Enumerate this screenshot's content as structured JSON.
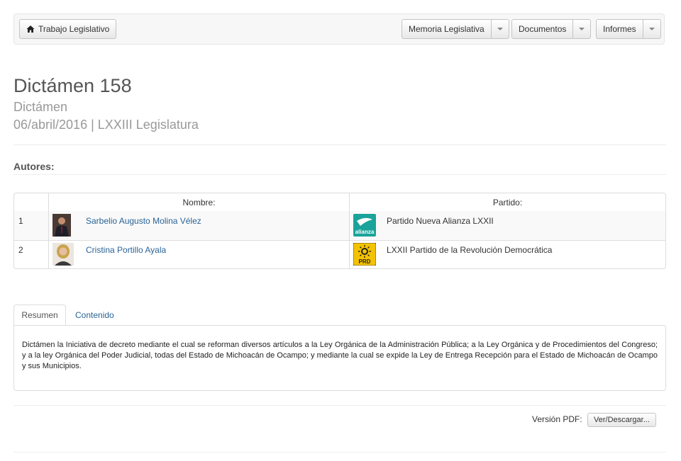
{
  "navbar": {
    "home_label": "Trabajo Legislativo",
    "menus": [
      {
        "label": "Memoria Legislativa"
      },
      {
        "label": "Documentos"
      },
      {
        "label": "Informes"
      }
    ]
  },
  "header": {
    "title": "Dictámen 158",
    "subtitle": "Dictámen",
    "date_line": "06/abril/2016 | LXXIII Legislatura"
  },
  "authors": {
    "section_label": "Autores:",
    "columns": [
      "Nombre:",
      "Partido:"
    ],
    "rows": [
      {
        "index": "1",
        "name": "Sarbelio Augusto Molina Vélez",
        "party": "Partido Nueva Alianza LXXII",
        "party_logo": "nueva-alianza-logo"
      },
      {
        "index": "2",
        "name": "Cristina Portillo Ayala",
        "party": "LXXII Partido de la Revolución Democrática",
        "party_logo": "prd-logo"
      }
    ]
  },
  "tabs": [
    {
      "label": "Resumen",
      "active": true
    },
    {
      "label": "Contenido",
      "active": false
    }
  ],
  "summary_text": "Dictámen la Iniciativa de decreto mediante el cual se reforman diversos artículos a la Ley Orgánica de la Administración Pública; a la Ley Orgánica y de Procedimientos del Congreso; y a la ley Orgánica del Poder Judicial, todas del Estado de Michoacán de Ocampo; y mediante la cual se expide la Ley de Entrega Recepción para el Estado de Michoacán de Ocampo y sus Municipios.",
  "pdf": {
    "label": "Versión PDF:",
    "button_label": "Ver/Descargar..."
  },
  "logo_text": {
    "nueva_alianza": "alianza",
    "prd": "PRD"
  }
}
